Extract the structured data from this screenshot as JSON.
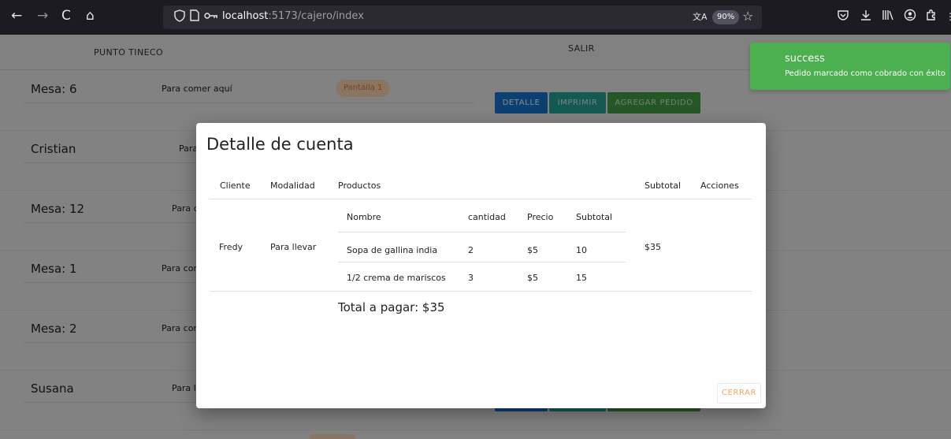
{
  "browser": {
    "nav_icons": [
      "←",
      "→",
      "C",
      "⌂"
    ],
    "url_host": "localhost",
    "url_path": ":5173/cajero/index",
    "zoom": "90%"
  },
  "header": {
    "brand": "PUNTO TINECO",
    "logout": "SALIR"
  },
  "rows": [
    {
      "name": "Mesa: 6",
      "modality": "Para comer aquí",
      "chip": "Pantalla 1"
    },
    {
      "name": "Cristian",
      "modality": "Para"
    },
    {
      "name": "Mesa: 12",
      "modality": "Para c"
    },
    {
      "name": "Mesa: 1",
      "modality": "Para com"
    },
    {
      "name": "Mesa: 2",
      "modality": "Para com"
    },
    {
      "name": "Susana",
      "modality": "Para ll"
    }
  ],
  "row_buttons": {
    "detail": "DETALLE",
    "print": "IMPRIMIR",
    "add": "AGREGAR PEDIDO"
  },
  "toast": {
    "title": "success",
    "message": "Pedido marcado como cobrado con éxito"
  },
  "modal": {
    "title": "Detalle de cuenta",
    "headers": {
      "client": "Cliente",
      "modality": "Modalidad",
      "products": "Productos",
      "subtotal": "Subtotal",
      "actions": "Acciones"
    },
    "product_headers": {
      "name": "Nombre",
      "qty": "cantidad",
      "price": "Precio",
      "subtotal": "Subtotal"
    },
    "order": {
      "client": "Fredy",
      "modality": "Para llevar",
      "subtotal": "$35",
      "products": [
        {
          "name": "Sopa de gallina india",
          "qty": "2",
          "price": "$5",
          "subtotal": "10"
        },
        {
          "name": "1/2 crema de mariscos",
          "qty": "3",
          "price": "$5",
          "subtotal": "15"
        }
      ]
    },
    "total": "Total a pagar: $35",
    "close": "CERRAR"
  }
}
